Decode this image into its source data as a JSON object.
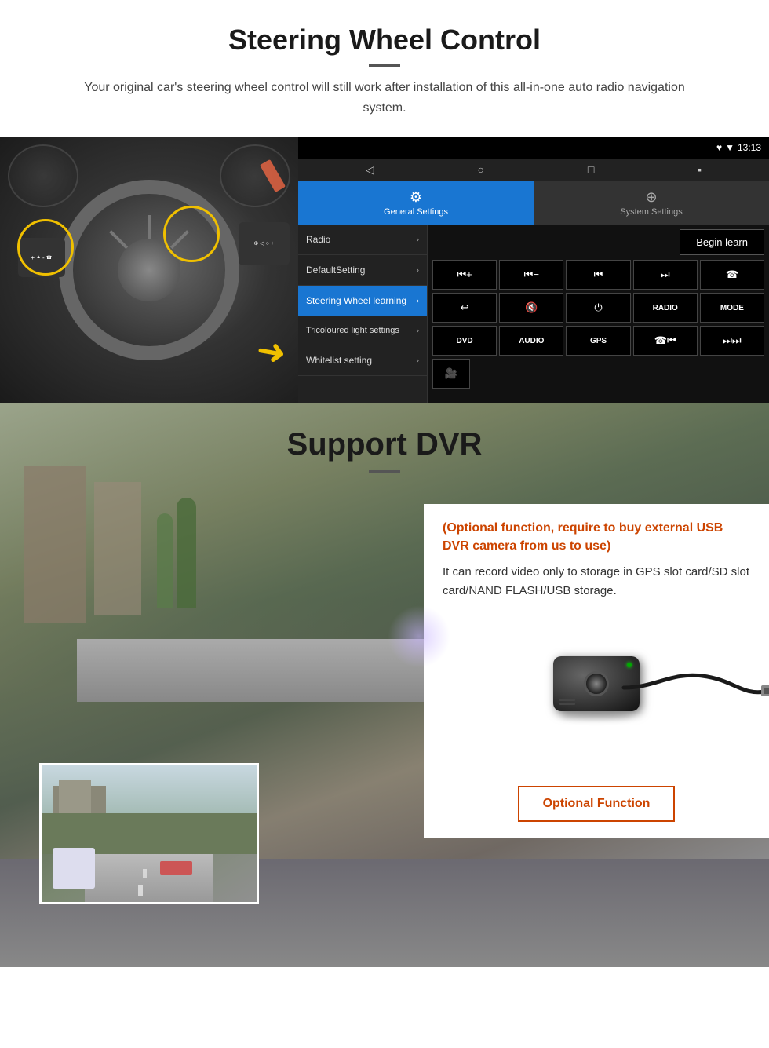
{
  "page": {
    "section1": {
      "title": "Steering Wheel Control",
      "subtitle": "Your original car's steering wheel control will still work after installation of this all-in-one auto radio navigation system.",
      "android": {
        "statusbar": {
          "time": "13:13",
          "wifi_icon": "▼",
          "signal_icon": "▲"
        },
        "nav_icons": [
          "◁",
          "○",
          "□",
          "▪"
        ],
        "tabs": [
          {
            "label": "General Settings",
            "icon": "⚙",
            "active": true
          },
          {
            "label": "System Settings",
            "icon": "⊕",
            "active": false
          }
        ],
        "menu_items": [
          {
            "label": "Radio",
            "active": false
          },
          {
            "label": "DefaultSetting",
            "active": false
          },
          {
            "label": "Steering Wheel learning",
            "active": true
          },
          {
            "label": "Tricoloured light settings",
            "active": false
          },
          {
            "label": "Whitelist setting",
            "active": false
          }
        ],
        "begin_learn": "Begin learn",
        "control_buttons_row1": [
          "⏮+",
          "⏮-",
          "⏮⏮",
          "⏭⏭",
          "☎"
        ],
        "control_buttons_row2": [
          "↩",
          "🔇×",
          "⏻",
          "RADIO",
          "MODE"
        ],
        "control_buttons_row3": [
          "DVD",
          "AUDIO",
          "GPS",
          "⏮",
          "⏭"
        ]
      }
    },
    "section2": {
      "title": "Support DVR",
      "optional_text": "(Optional function, require to buy external USB DVR camera from us to use)",
      "desc_text": "It can record video only to storage in GPS slot card/SD slot card/NAND FLASH/USB storage.",
      "optional_function_label": "Optional Function"
    }
  }
}
